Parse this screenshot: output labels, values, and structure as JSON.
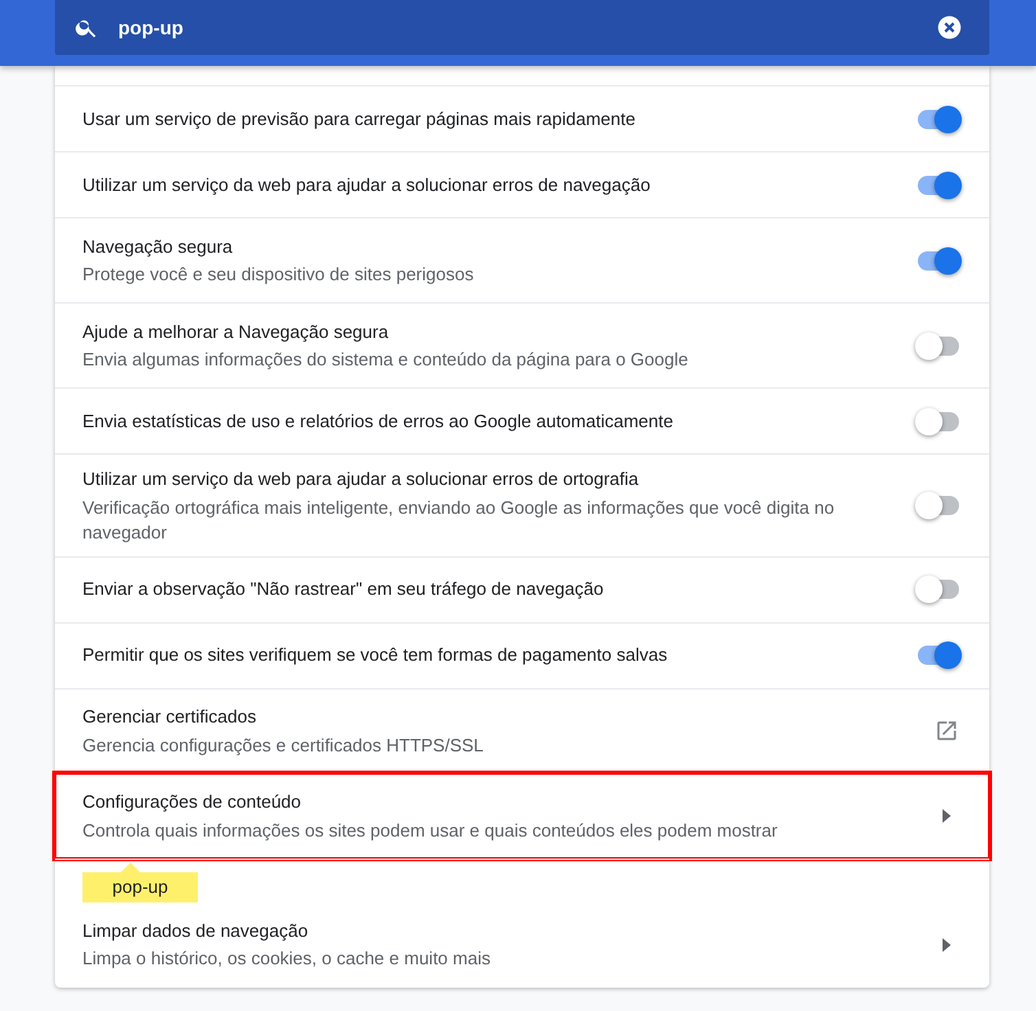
{
  "search": {
    "value": "pop-up"
  },
  "rows": [
    {
      "kind": "toggle",
      "title": "Usar um serviço de previsão para carregar páginas mais rapidamente",
      "on": true
    },
    {
      "kind": "toggle",
      "title": "Utilizar um serviço da web para ajudar a solucionar erros de navegação",
      "on": true
    },
    {
      "kind": "toggle",
      "title": "Navegação segura",
      "subtitle": "Protege você e seu dispositivo de sites perigosos",
      "on": true
    },
    {
      "kind": "toggle",
      "title": "Ajude a melhorar a Navegação segura",
      "subtitle": "Envia algumas informações do sistema e conteúdo da página para o Google",
      "on": false
    },
    {
      "kind": "toggle",
      "title": "Envia estatísticas de uso e relatórios de erros ao Google automaticamente",
      "on": false
    },
    {
      "kind": "toggle",
      "title": "Utilizar um serviço da web para ajudar a solucionar erros de ortografia",
      "subtitle": "Verificação ortográfica mais inteligente, enviando ao Google as informações que você digita no navegador",
      "on": false
    },
    {
      "kind": "toggle",
      "title": "Enviar a observação \"Não rastrear\" em seu tráfego de navegação",
      "on": false
    },
    {
      "kind": "toggle",
      "title": "Permitir que os sites verifiquem se você tem formas de pagamento salvas",
      "on": true
    },
    {
      "kind": "external",
      "title": "Gerenciar certificados",
      "subtitle": "Gerencia configurações e certificados HTTPS/SSL"
    },
    {
      "kind": "arrow",
      "title": "Configurações de conteúdo",
      "subtitle": "Controla quais informações os sites podem usar e quais conteúdos eles podem mostrar",
      "highlighted": true,
      "bubble": "pop-up"
    },
    {
      "kind": "arrow",
      "title": "Limpar dados de navegação",
      "subtitle": "Limpa o histórico, os cookies, o cache e muito mais",
      "highlighted": false
    }
  ]
}
